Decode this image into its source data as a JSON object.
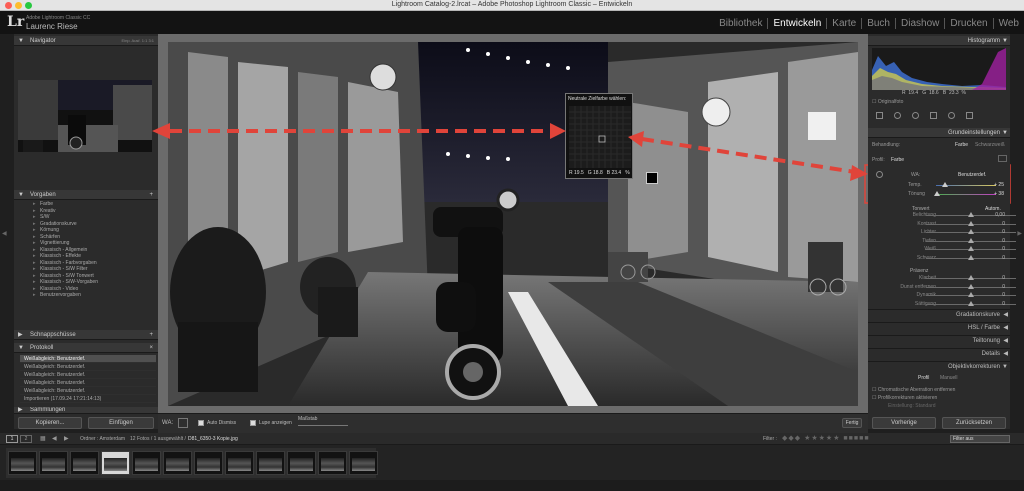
{
  "window": {
    "title": "Lightroom Catalog-2.lrcat – Adobe Photoshop Lightroom Classic – Entwickeln"
  },
  "identity": {
    "logo": "Lr",
    "app_line": "Adobe Lightroom Classic CC",
    "user": "Laurenc Riese"
  },
  "modules": [
    {
      "label": "Bibliothek",
      "active": false
    },
    {
      "label": "Entwickeln",
      "active": true
    },
    {
      "label": "Karte",
      "active": false
    },
    {
      "label": "Buch",
      "active": false
    },
    {
      "label": "Diashow",
      "active": false
    },
    {
      "label": "Drucken",
      "active": false
    },
    {
      "label": "Web",
      "active": false
    }
  ],
  "left": {
    "navigator": {
      "title": "Navigator",
      "zoom_options": "Einp.  Ausf.  1:1  3:1"
    },
    "presets": {
      "title": "Vorgaben",
      "items": [
        "Farbe",
        "Kreativ",
        "S/W",
        "Gradationskurve",
        "Körnung",
        "Schärfen",
        "Vignettierung",
        "Klassisch - Allgemein",
        "Klassisch - Effekte",
        "Klassisch - Farbvorgaben",
        "Klassisch - S/W Filter",
        "Klassisch - S/W Tonwert",
        "Klassisch - S/W-Vorgaben",
        "Klassisch - Video",
        "Benutzervorgaben"
      ]
    },
    "snapshots": {
      "title": "Schnappschüsse"
    },
    "history": {
      "title": "Protokoll",
      "items": [
        "Weißabgleich: Benutzerdef.",
        "Weißabgleich: Benutzerdef.",
        "Weißabgleich: Benutzerdef.",
        "Weißabgleich: Benutzerdef.",
        "Weißabgleich: Benutzerdef.",
        "Importieren (17.09.24 17:21:14:13)"
      ]
    },
    "collections": {
      "title": "Sammlungen"
    },
    "copy_label": "Kopieren...",
    "paste_label": "Einfügen"
  },
  "toolbar": {
    "wb_label": "WA:",
    "auto_dismiss": "Auto Dismiss",
    "show_loupe": "Lupe anzeigen",
    "scale_label": "Maßstab",
    "done_label": "Fertig"
  },
  "loupe": {
    "title": "Neutrale Zielfarbe wählen:",
    "r": "R 19.5",
    "g": "G 18.8",
    "b": "B 23.4",
    "unit": "%"
  },
  "right": {
    "histogram": {
      "title": "Histogramm",
      "readout": "R  19.4   G  18.6   B  23.3  %",
      "original_photo": "Originalfoto"
    },
    "basic": {
      "title": "Grundeinstellungen",
      "treatment_label": "Behandlung:",
      "color_label": "Farbe",
      "bw_label": "Schwarzweiß",
      "profile_label": "Profil:",
      "profile_value": "Farbe",
      "wb_label": "WA:",
      "wb_value": "Benutzerdef.",
      "temp_label": "Temp.",
      "temp_value": "+ 25",
      "tint_label": "Tönung",
      "tint_value": "+ 38",
      "tone_label": "Tonwert",
      "tone_auto": "Autom.",
      "sliders": [
        {
          "label": "Belichtung",
          "value": "0,00",
          "pos": 0.5
        },
        {
          "label": "Kontrast",
          "value": "0",
          "pos": 0.5
        },
        {
          "label": "Lichter",
          "value": "0",
          "pos": 0.5
        },
        {
          "label": "Tiefen",
          "value": "0",
          "pos": 0.5
        },
        {
          "label": "Weiß",
          "value": "0",
          "pos": 0.5
        },
        {
          "label": "Schwarz",
          "value": "0",
          "pos": 0.5
        }
      ],
      "presence_label": "Präsenz",
      "presence": [
        {
          "label": "Klarheit",
          "value": "0",
          "pos": 0.5
        },
        {
          "label": "Dunst entfernen",
          "value": "0",
          "pos": 0.5
        },
        {
          "label": "Dynamik",
          "value": "0",
          "pos": 0.5
        },
        {
          "label": "Sättigung",
          "value": "0",
          "pos": 0.5
        }
      ]
    },
    "sections": [
      {
        "label": "Gradationskurve"
      },
      {
        "label": "HSL / Farbe"
      },
      {
        "label": "Teiltonung"
      },
      {
        "label": "Details"
      },
      {
        "label": "Objektivkorrekturen"
      }
    ],
    "lens": {
      "tab_profile": "Profil",
      "tab_manual": "Manuell",
      "opt1": "Chromatische Aberration entfernen",
      "opt2": "Profilkorrekturen aktivieren",
      "setup": "Einstellung:  Standard"
    },
    "prev_label": "Vorherige",
    "reset_label": "Zurücksetzen"
  },
  "filmstrip": {
    "page1": "1",
    "page2": "2",
    "source": "Ordner : Amsterdam",
    "count": "12 Fotos / 1 ausgewählt /",
    "filename": "D81_6350-3 Kopie.jpg",
    "filter_label": "Filter :",
    "filter_value": "Filter aus",
    "thumb_count": 12,
    "selected_index": 3
  },
  "colors": {
    "accent_red": "#e0443a",
    "panel": "#2b2b2b",
    "active_module": "#ffffff"
  }
}
